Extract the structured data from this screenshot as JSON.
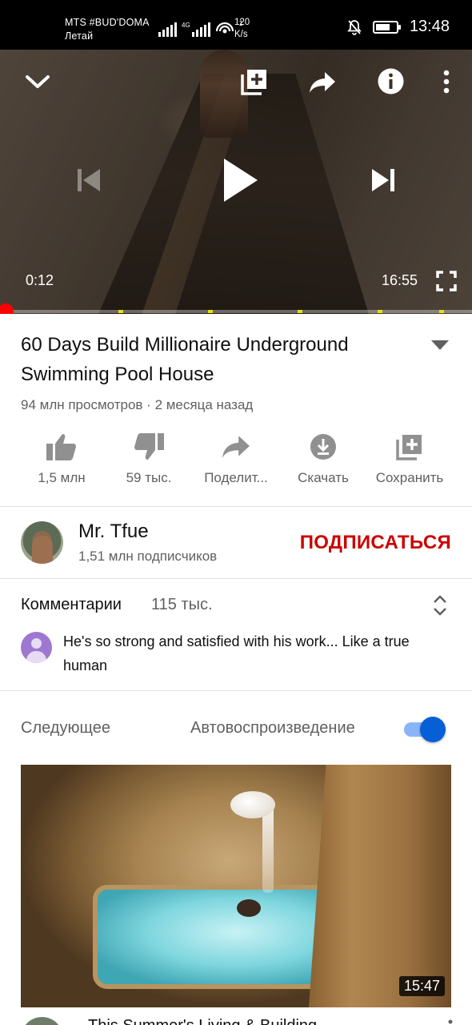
{
  "status_bar": {
    "carrier_line1": "MTS #BUD'DOMA",
    "carrier_line2": "Летай",
    "net_speed_value": "120",
    "net_speed_unit": "K/s",
    "clock": "13:48",
    "battery_level": 0.7,
    "network_label": "4G"
  },
  "player": {
    "current_time": "0:12",
    "duration": "16:55",
    "progress_fraction": 0.012,
    "chapter_marker_fractions": [
      0.25,
      0.44,
      0.63,
      0.8,
      0.93
    ],
    "icons": [
      "collapse-chevron-icon",
      "add-to-playlist-icon",
      "share-icon",
      "info-icon",
      "more-vert-icon",
      "previous-icon",
      "play-icon",
      "next-icon",
      "fullscreen-icon"
    ]
  },
  "video": {
    "title": "60 Days Build Millionaire Underground Swimming Pool House",
    "meta": "94 млн просмотров · 2 месяца назад"
  },
  "actions": [
    {
      "name": "like",
      "icon": "thumb-up-icon",
      "label": "1,5 млн"
    },
    {
      "name": "dislike",
      "icon": "thumb-down-icon",
      "label": "59 тыс."
    },
    {
      "name": "share",
      "icon": "share-icon",
      "label": "Поделит..."
    },
    {
      "name": "download",
      "icon": "download-icon",
      "label": "Скачать"
    },
    {
      "name": "save",
      "icon": "add-to-playlist-icon",
      "label": "Сохранить"
    }
  ],
  "channel": {
    "name": "Mr. Tfue",
    "subscribers": "1,51 млн подписчиков",
    "subscribe_label": "ПОДПИСАТЬСЯ"
  },
  "comments": {
    "title": "Комментарии",
    "count": "115 тыс.",
    "top_comment": "He's so strong and satisfied with his work... Like a true human"
  },
  "up_next": {
    "label": "Следующее",
    "autoplay_label": "Автовоспроизведение",
    "autoplay_on": true,
    "duration": "15:47",
    "partial_title": "This Summer's Living & Building"
  },
  "colors": {
    "accent_red": "#cc0000",
    "progress_red": "#ff0000",
    "toggle_blue": "#065fd4",
    "secondary_text": "#606060"
  }
}
